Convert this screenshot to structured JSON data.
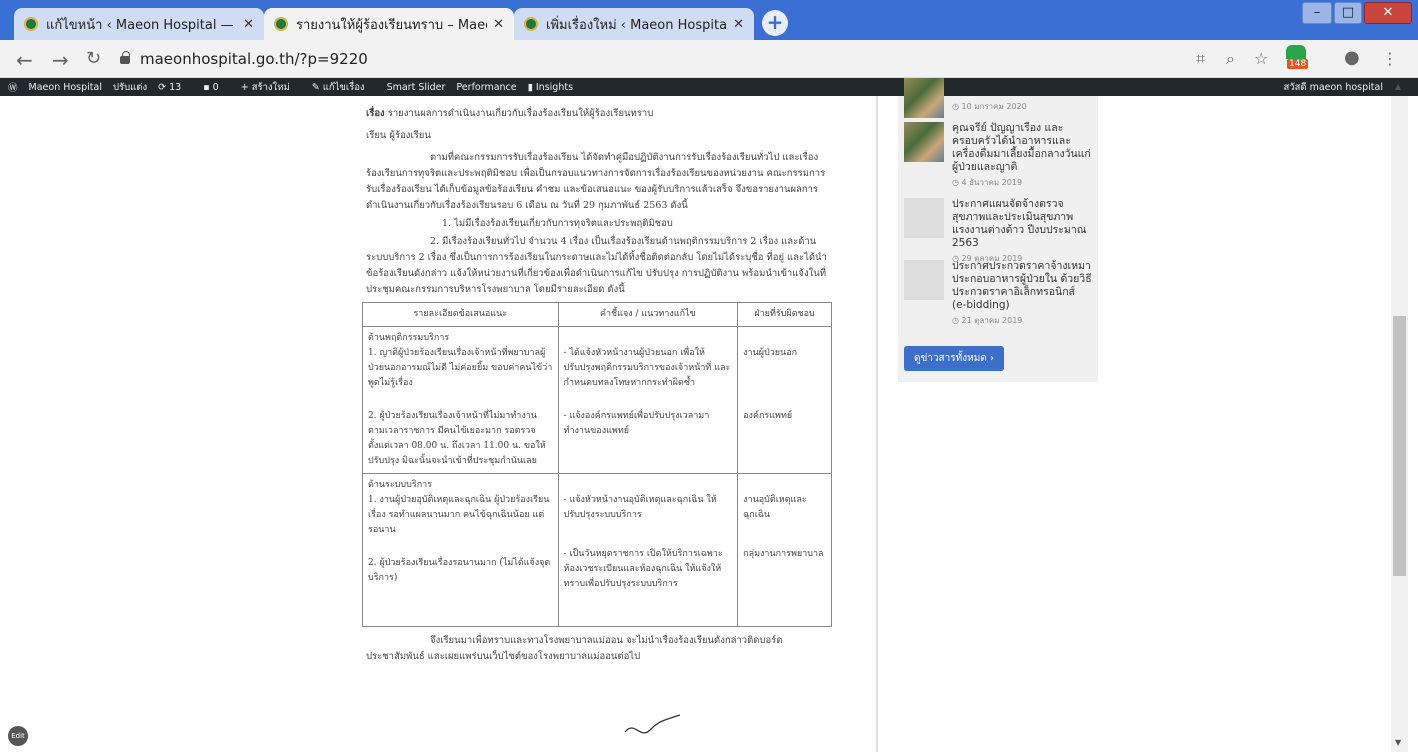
{
  "browser": {
    "tabs": [
      {
        "title": "แก้ไขหน้า ‹ Maeon Hospital — W",
        "close": "✕"
      },
      {
        "title": "รายงานให้ผู้ร้องเรียนทราบ – Maeon",
        "close": "✕"
      },
      {
        "title": "เพิ่มเรื่องใหม่ ‹ Maeon Hospital —",
        "close": "✕"
      }
    ],
    "new_tab": "+",
    "window_controls": {
      "minimize": "–",
      "maximize": "□",
      "close": "✕"
    },
    "url": "maeonhospital.go.th/?p=9220",
    "extension_badge": "148"
  },
  "admin_bar": {
    "items": [
      "Maeon Hospital",
      "ปรับแต่ง",
      "13",
      "0",
      "สร้างใหม่",
      "แก้ไขเรื่อง",
      "Smart Slider",
      "Performance",
      "Insights"
    ],
    "greeting": "สวัสดี maeon hospital"
  },
  "document": {
    "subject_label": "เรื่อง",
    "subject": "รายงานผลการดำเนินงานเกี่ยวกับเรื่องร้องเรียนให้ผู้ร้องเรียนทราบ",
    "salutation": "เรียน ผู้ร้องเรียน",
    "para1": "ตามที่คณะกรรมการรับเรื่องร้องเรียน ได้จัดทำคู่มือปฏิบัติงานการรับเรื่องร้องเรียนทั่วไป และเรื่องร้องเรียนการทุจริตและประพฤติมิชอบ เพื่อเป็นกรอบแนวทางการจัดการเรื่องร้องเรียนของหน่วยงาน คณะกรรมการรับเรื่องร้องเรียน ได้เก็บข้อมูลข้อร้องเรียน คำชม และข้อเสนอแนะ ของผู้รับบริการแล้วเสร็จ จึงขอรายงานผลการดำเนินงานเกี่ยวกับเรื่องร้องเรียนรอบ 6 เดือน ณ วันที่ 29 กุมภาพันธ์ 2563 ดังนี้",
    "item1": "1. ไม่มีเรื่องร้องเรียนเกี่ยวกับการทุจริตและประพฤติมิชอบ",
    "item2": "2. มีเรื่องร้องเรียนทั่วไป จำนวน 4 เรื่อง เป็นเรื่องร้องเรียนด้านพฤติกรรมบริการ 2 เรื่อง และด้านระบบบริการ 2 เรื่อง ซึ่งเป็นการการร้องเรียนในกระดาษและไม่ได้ทิ้งชื่อติดต่อกลับ โดยไม่ได้ระบุชื่อ ที่อยู่ และได้นำข้อร้องเรียนดังกล่าว แจ้งให้หน่วยงานที่เกี่ยวข้องเพื่อดำเนินการแก้ไข ปรับปรุง การปฏิบัติงาน พร้อมนำเข้าแจ้งในที่ประชุมคณะกรรมการบริหารโรงพยาบาล โดยมีรายละเอียด ดังนี้",
    "table": {
      "headers": [
        "รายละเอียดข้อเสนอแนะ",
        "คำชี้แจง / แนวทางแก้ไข",
        "ฝ่ายที่รับผิดชอบ"
      ],
      "section1": "ด้านพฤติกรรมบริการ",
      "rows1": [
        [
          "1. ญาติผู้ป่วยร้องเรียนเรื่องเจ้าหน้าที่พยาบาลผู้ป่วยนอกอารมณ์ไม่ดี ไม่ค่อยยิ้ม ขอบค่าคนไข้ว่าพูดไม่รู้เรื่อง",
          "- ได้แจ้งหัวหน้างานผู้ป่วยนอก เพื่อให้ปรับปรุงพฤติกรรมบริการของเจ้าหน้าที่ และกำหนดบทลงโทษหากกระทำผิดซ้ำ",
          "งานผู้ป่วยนอก"
        ],
        [
          "2. ผู้ป่วยร้องเรียนเรื่องเจ้าหน้าที่ไม่มาทำงานตามเวลาราชการ มีคนไข้เยอะมาก รอตรวจตั้งแต่เวลา 08.00 น. ถึงเวลา 11.00 น. ขอให้ปรับปรุง มิฉะนั้นจะนำเข้าที่ประชุมกำนันเลย",
          "- แจ้งองค์กรแพทย์เพื่อปรับปรุงเวลามาทำงานของแพทย์",
          "องค์กรแพทย์"
        ]
      ],
      "section2": "ด้านระบบบริการ",
      "rows2": [
        [
          "1. งานผู้ป่วยอุบัติเหตุและฉุกเฉิน ผู้ป่วยร้องเรียนเรื่อง รอทำแผลนานมาก คนไข้ฉุกเฉินน้อย แต่รอนาน",
          "- แจ้งหัวหน้างานอุบัติเหตุและฉุกเฉิน ให้ปรับปรุงระบบบริการ",
          "งานอุบัติเหตุและฉุกเฉิน"
        ],
        [
          "2. ผู้ป่วยร้องเรียนเรื่องรอนานมาก (ไม่ได้แจ้งจุดบริการ)",
          "- เป็นวันหยุดราชการ เปิดให้บริการเฉพาะห้องเวชระเบียนและห้องฉุกเฉิน ให้แจ้งให้ทราบเพื่อปรับปรุงระบบบริการ",
          "กลุ่มงานการพยาบาล"
        ]
      ]
    },
    "closing": "จึงเรียนมาเพื่อทราบและทางโรงพยาบาลแม่ออน จะไม่นำเรื่องร้องเรียนดังกล่าวติดบอร์ดประชาสัมพันธ์ และเผยแพร่บนเว็บไซต์ของโรงพยาบาลแม่ออนต่อไป"
  },
  "sidebar": {
    "posts": [
      {
        "title": "",
        "date": "10 มกราคม 2020"
      },
      {
        "title": "คุณจรีย์ ปัญญาเรือง และครอบครัวได้นำอาหารและเครื่องดื่มมาเลี้ยงมื้อกลางวันแก่ผู้ป่วยและญาติ",
        "date": "4 ธันวาคม 2019"
      },
      {
        "title": "ประกาศแผนจัดจ้างตรวจสุขภาพและประเมินสุขภาพแรงงานต่างด้าว ปีงบประมาณ 2563",
        "date": "29 ตุลาคม 2019"
      },
      {
        "title": "ประกาศประกวดราคาจ้างเหมาประกอบอาหารผู้ป่วยใน ด้วยวิธีประกวดราคาอิเล็กทรอนิกส์ (e-bidding)",
        "date": "21 ตุลาคม 2019"
      }
    ],
    "all_news_button": "ดูข่าวสารทั้งหมด ›"
  },
  "edit_bubble": "Edit"
}
